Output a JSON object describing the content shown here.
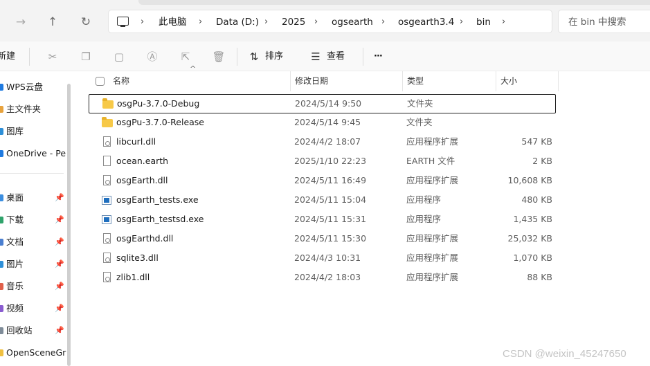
{
  "nav": {
    "back": "←",
    "forward": "→",
    "up": "↑",
    "refresh": "↻"
  },
  "breadcrumb": {
    "items": [
      "此电脑",
      "Data (D:)",
      "2025",
      "ogsearth",
      "osgearth3.4",
      "bin"
    ],
    "separator": "›",
    "root_icon": "computer-icon"
  },
  "search": {
    "placeholder": "在 bin 中搜索"
  },
  "commandbar": {
    "new_label": "新建",
    "sort_label": "排序",
    "view_label": "查看",
    "more_label": "···",
    "icons": [
      "cut-icon",
      "copy-icon",
      "paste-icon",
      "rename-icon",
      "share-icon",
      "delete-icon"
    ]
  },
  "sidebar": {
    "items": [
      {
        "label": "WPS云盘",
        "color": "#1f7ae0",
        "pinned": false
      },
      {
        "label": "主文件夹",
        "color": "#e8a33d",
        "pinned": false
      },
      {
        "label": "图库",
        "color": "#2d8fd8",
        "pinned": false
      },
      {
        "label": "OneDrive - Per",
        "color": "#1f7ae0",
        "pinned": false
      },
      {
        "label": "桌面",
        "color": "#3b8ee0",
        "pinned": true
      },
      {
        "label": "下载",
        "color": "#2fa36b",
        "pinned": true
      },
      {
        "label": "文档",
        "color": "#4a7fd0",
        "pinned": true
      },
      {
        "label": "图片",
        "color": "#2d8fd8",
        "pinned": true
      },
      {
        "label": "音乐",
        "color": "#e0604a",
        "pinned": true
      },
      {
        "label": "视频",
        "color": "#8a5cd0",
        "pinned": true
      },
      {
        "label": "回收站",
        "color": "#7f8c99",
        "pinned": true
      },
      {
        "label": "OpenSceneGra",
        "color": "#f0c040",
        "pinned": false
      }
    ],
    "pin_glyph": "📌"
  },
  "table": {
    "headers": {
      "name": "名称",
      "modified": "修改日期",
      "type": "类型",
      "size": "大小"
    },
    "sort_caret": "^",
    "rows": [
      {
        "name": "osgPu-3.7.0-Debug",
        "modified": "2024/5/14 9:50",
        "type": "文件夹",
        "size": "",
        "icon": "folder-icon",
        "selected": true
      },
      {
        "name": "osgPu-3.7.0-Release",
        "modified": "2024/5/14 9:45",
        "type": "文件夹",
        "size": "",
        "icon": "folder-icon",
        "selected": false
      },
      {
        "name": "libcurl.dll",
        "modified": "2024/4/2 18:07",
        "type": "应用程序扩展",
        "size": "547 KB",
        "icon": "dll-icon",
        "selected": false
      },
      {
        "name": "ocean.earth",
        "modified": "2025/1/10 22:23",
        "type": "EARTH 文件",
        "size": "2 KB",
        "icon": "document-icon",
        "selected": false
      },
      {
        "name": "osgEarth.dll",
        "modified": "2024/5/11 16:49",
        "type": "应用程序扩展",
        "size": "10,608 KB",
        "icon": "dll-icon",
        "selected": false
      },
      {
        "name": "osgEarth_tests.exe",
        "modified": "2024/5/11 15:04",
        "type": "应用程序",
        "size": "480 KB",
        "icon": "exe-icon",
        "selected": false
      },
      {
        "name": "osgEarth_testsd.exe",
        "modified": "2024/5/11 15:31",
        "type": "应用程序",
        "size": "1,435 KB",
        "icon": "exe-icon",
        "selected": false
      },
      {
        "name": "osgEarthd.dll",
        "modified": "2024/5/11 15:30",
        "type": "应用程序扩展",
        "size": "25,032 KB",
        "icon": "dll-icon",
        "selected": false
      },
      {
        "name": "sqlite3.dll",
        "modified": "2024/4/3 10:31",
        "type": "应用程序扩展",
        "size": "1,070 KB",
        "icon": "dll-icon",
        "selected": false
      },
      {
        "name": "zlib1.dll",
        "modified": "2024/4/2 18:03",
        "type": "应用程序扩展",
        "size": "88 KB",
        "icon": "dll-icon",
        "selected": false
      }
    ]
  },
  "watermark": "CSDN @weixin_45247650"
}
